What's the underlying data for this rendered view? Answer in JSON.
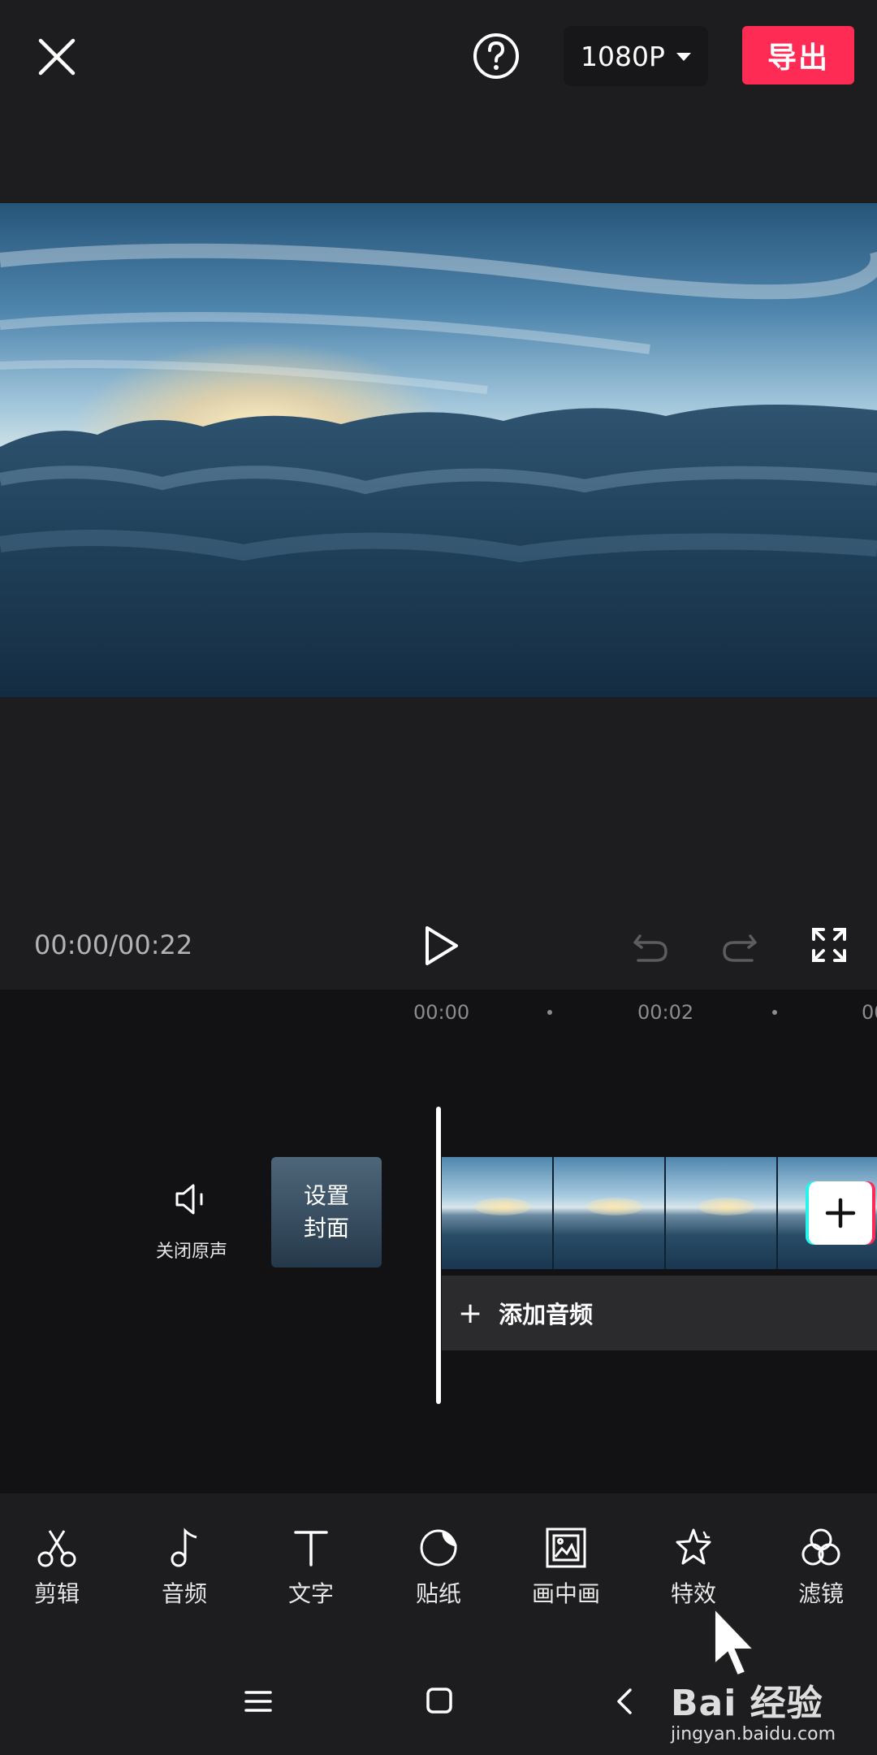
{
  "header": {
    "close_icon": "close-icon",
    "help_icon": "help-icon",
    "resolution": "1080P",
    "export_label": "导出",
    "accent_color": "#fe2c55"
  },
  "player": {
    "timecode": "00:00/00:22",
    "play_icon": "play-icon",
    "undo_icon": "undo-icon",
    "redo_icon": "redo-icon",
    "fullscreen_icon": "fullscreen-icon"
  },
  "timeline": {
    "ruler": [
      "00:00",
      "00:02",
      "00"
    ],
    "mute_label": "关闭原声",
    "cover_line1": "设置",
    "cover_line2": "封面",
    "add_audio_label": "添加音频",
    "add_clip_icon": "plus-icon"
  },
  "toolbar": {
    "items": [
      {
        "label": "剪辑",
        "icon": "scissors-icon"
      },
      {
        "label": "音频",
        "icon": "music-note-icon"
      },
      {
        "label": "文字",
        "icon": "text-icon"
      },
      {
        "label": "贴纸",
        "icon": "sticker-icon"
      },
      {
        "label": "画中画",
        "icon": "picture-in-picture-icon"
      },
      {
        "label": "特效",
        "icon": "star-effect-icon"
      },
      {
        "label": "滤镜",
        "icon": "filter-icon"
      }
    ]
  },
  "system_nav": {
    "menu_icon": "menu-icon",
    "home_icon": "home-icon",
    "back_icon": "back-icon"
  },
  "watermark": {
    "brand": "Bai 经验",
    "url": "jingyan.baidu.com"
  }
}
